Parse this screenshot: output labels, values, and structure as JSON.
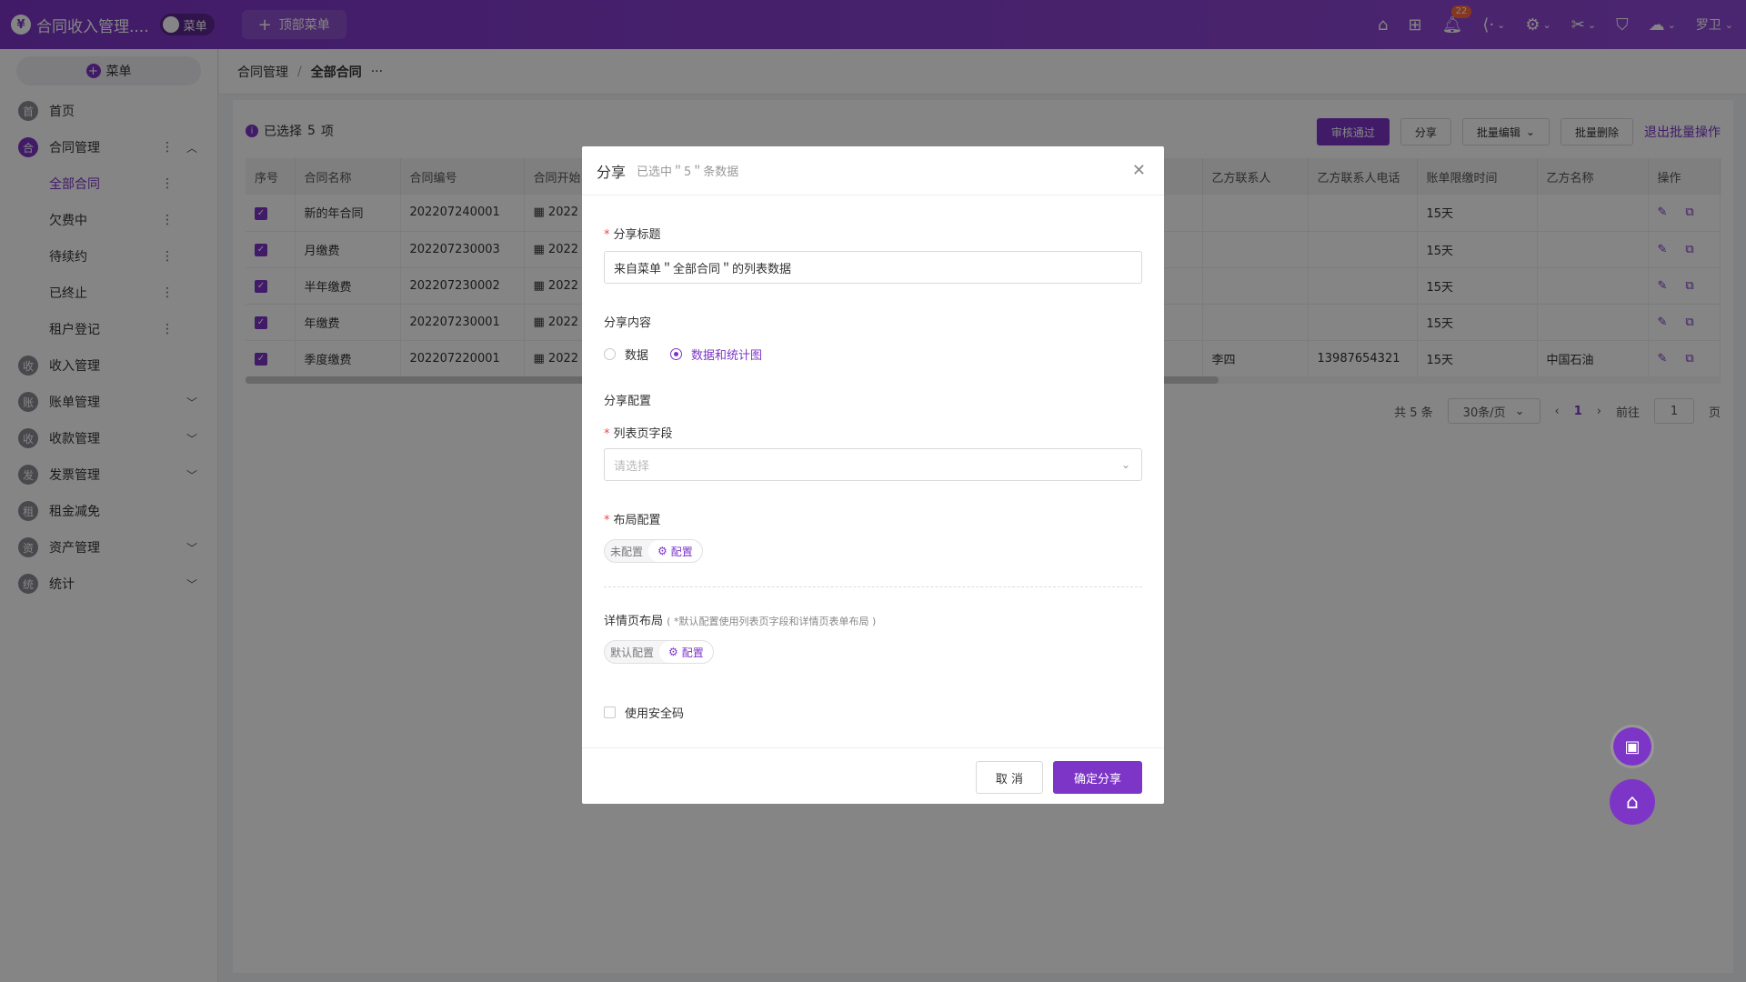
{
  "app": {
    "logo": "¥",
    "title": "合同收入管理....",
    "switch_label": "菜单",
    "top_menu_label": "顶部菜单",
    "notif_count": "22",
    "user": "罗卫"
  },
  "sidebar": {
    "menu_button": "菜单",
    "items": [
      {
        "icon_char": "首",
        "label": "首页"
      },
      {
        "icon_char": "合",
        "label": "合同管理"
      },
      {
        "icon_char": "收",
        "label": "收入管理"
      },
      {
        "icon_char": "账",
        "label": "账单管理"
      },
      {
        "icon_char": "收",
        "label": "收款管理"
      },
      {
        "icon_char": "发",
        "label": "发票管理"
      },
      {
        "icon_char": "租",
        "label": "租金减免"
      },
      {
        "icon_char": "资",
        "label": "资产管理"
      },
      {
        "icon_char": "统",
        "label": "统计"
      }
    ],
    "sub_items": [
      "全部合同",
      "欠费中",
      "待续约",
      "已终止",
      "租户登记"
    ]
  },
  "breadcrumb": {
    "parent": "合同管理",
    "current": "全部合同",
    "more": "···"
  },
  "selection": {
    "prefix": "已选择",
    "count": "5",
    "suffix": "项"
  },
  "actions": {
    "approve": "审核通过",
    "share": "分享",
    "batch_edit": "批量编辑",
    "batch_delete": "批量删除",
    "exit": "退出批量操作"
  },
  "table": {
    "headers": [
      "序号",
      "合同名称",
      "合同编号",
      "合同开始",
      "",
      "乙方联系人",
      "乙方联系人电话",
      "账单限缴时间",
      "乙方名称",
      "操作"
    ],
    "rows": [
      {
        "name": "新的年合同",
        "code": "202207240001",
        "start": "2022",
        "contact": "",
        "phone": "",
        "limit": "15天",
        "party": ""
      },
      {
        "name": "月缴费",
        "code": "202207230003",
        "start": "2022",
        "contact": "",
        "phone": "",
        "limit": "15天",
        "party": ""
      },
      {
        "name": "半年缴费",
        "code": "202207230002",
        "start": "2022",
        "contact": "",
        "phone": "",
        "limit": "15天",
        "party": ""
      },
      {
        "name": "年缴费",
        "code": "202207230001",
        "start": "2022",
        "contact": "",
        "phone": "",
        "limit": "15天",
        "party": ""
      },
      {
        "name": "季度缴费",
        "code": "202207220001",
        "start": "2022",
        "contact": "李四",
        "phone": "13987654321",
        "limit": "15天",
        "party": "中国石油"
      }
    ]
  },
  "pager": {
    "total": "共 5 条",
    "page_size": "30条/页",
    "current": "1",
    "goto": "前往",
    "goto_value": "1",
    "page_unit": "页"
  },
  "modal": {
    "title": "分享",
    "subtitle": "已选中＂5＂条数据",
    "share_title_label": "分享标题",
    "share_title_value": "来自菜单＂全部合同＂的列表数据",
    "content_label": "分享内容",
    "radio_data": "数据",
    "radio_data_chart": "数据和统计图",
    "config_label": "分享配置",
    "list_field_label": "列表页字段",
    "list_field_placeholder": "请选择",
    "layout_label": "布局配置",
    "layout_state": "未配置",
    "layout_btn": "配置",
    "detail_label": "详情页布局",
    "detail_hint": "( *默认配置使用列表页字段和详情页表单布局 )",
    "detail_state": "默认配置",
    "detail_btn": "配置",
    "safe_code": "使用安全码",
    "cancel": "取 消",
    "confirm": "确定分享"
  }
}
